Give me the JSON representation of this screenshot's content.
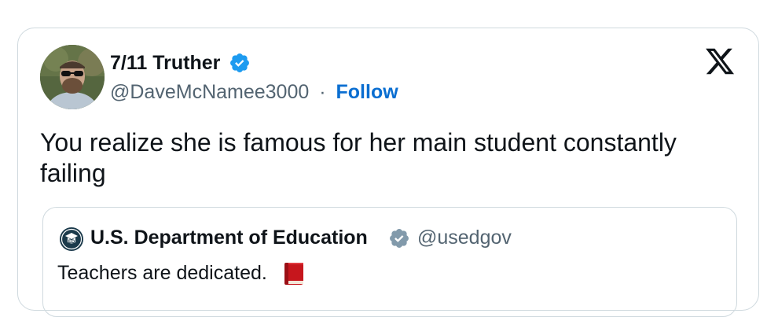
{
  "tweet": {
    "author_name": "7/11 Truther",
    "author_handle": "@DaveMcNamee3000",
    "separator": "·",
    "follow_label": "Follow",
    "text": "You realize she is famous for her main student constantly failing"
  },
  "quoted_tweet": {
    "author_name": "U.S. Department of Education",
    "author_handle": "@usedgov",
    "text": "Teachers are dedicated."
  },
  "colors": {
    "link": "#0a6ed1",
    "verified_blue": "#1d9bf0",
    "verified_gray": "#829aab",
    "border": "#cfd9de",
    "secondary_text": "#536471"
  },
  "icons": {
    "verified": "verified-badge-icon",
    "logo": "x-logo-icon",
    "book": "red-book-emoji",
    "org_seal": "education-dept-seal"
  }
}
